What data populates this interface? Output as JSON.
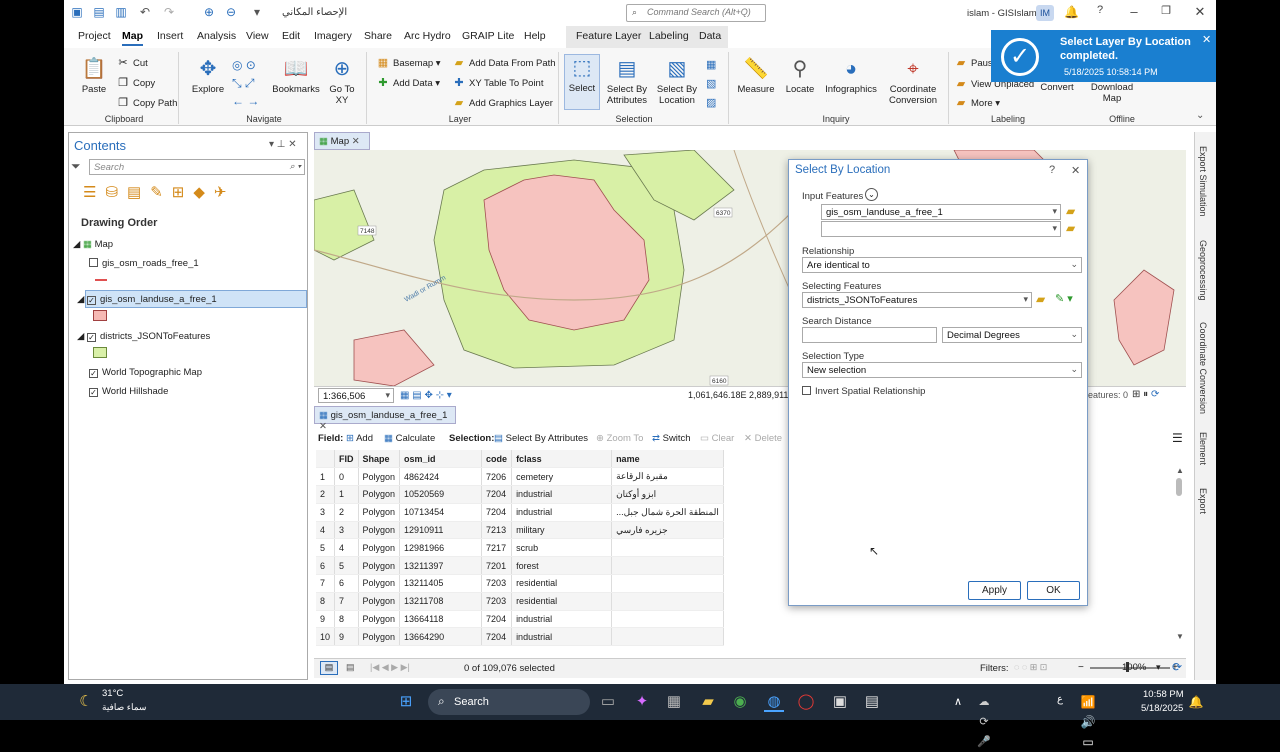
{
  "titlebar": {
    "project": "الإحصاء المكاني",
    "search_placeholder": "Command Search (Alt+Q)",
    "app_title": "islam - GISIslam",
    "avatar": "IM",
    "help": "?"
  },
  "menu": {
    "items": [
      "Project",
      "Map",
      "Insert",
      "Analysis",
      "View",
      "Edit",
      "Imagery",
      "Share",
      "Arc Hydro",
      "GRAIP Lite",
      "Help"
    ],
    "ctx": [
      "Feature Layer",
      "Labeling",
      "Data"
    ]
  },
  "ribbon": {
    "paste": "Paste",
    "cut": "Cut",
    "copy": "Copy",
    "copy_path": "Copy Path",
    "clipboard": "Clipboard",
    "explore": "Explore",
    "bookmarks": "Bookmarks",
    "goto": "Go To XY",
    "navigate": "Navigate",
    "basemap": "Basemap",
    "add_data": "Add Data",
    "add_from_path": "Add Data From Path",
    "xy_table": "XY Table To Point",
    "add_graphics": "Add Graphics Layer",
    "layer": "Layer",
    "select": "Select",
    "sel_attr": "Select By Attributes",
    "sel_loc": "Select By Location",
    "selection": "Selection",
    "measure": "Measure",
    "locate": "Locate",
    "infographics": "Infographics",
    "coord_conv": "Coordinate Conversion",
    "inquiry": "Inquiry",
    "pause": "Pause",
    "view_unplaced": "View Unplaced",
    "more": "More",
    "labeling": "Labeling",
    "convert": "Convert",
    "download_map": "Download Map",
    "offline": "Offline"
  },
  "toast": {
    "title": "Select Layer By Location completed.",
    "time": "5/18/2025 10:58:14 PM"
  },
  "contents": {
    "title": "Contents",
    "search_placeholder": "Search",
    "drawing_order": "Drawing Order",
    "map": "Map",
    "layers": [
      "gis_osm_roads_free_1",
      "gis_osm_landuse_a_free_1",
      "districts_JSONToFeatures",
      "World Topographic Map",
      "World Hillshade"
    ],
    "colors": {
      "roads": "#e05050",
      "landuse": "#f6b9b4",
      "districts": "#d9f0a8"
    }
  },
  "map": {
    "tab": "Map",
    "scale": "1:366,506",
    "coords": "1,061,646.18E 2,889,911.8",
    "features": "eatures: 0",
    "labels": {
      "road1": "6370",
      "road2": "7148",
      "road3": "6160",
      "wadi": "Wadi or Rumm"
    },
    "colors": {
      "landuse": "#f6c3bf",
      "districts": "#d8f0a6",
      "base": "#eef0e6"
    }
  },
  "table": {
    "tab": "gis_osm_landuse_a_free_1",
    "field": "Field:",
    "add": "Add",
    "calculate": "Calculate",
    "selection": "Selection:",
    "sel_attr": "Select By Attributes",
    "zoom": "Zoom To",
    "switch": "Switch",
    "clear": "Clear",
    "delete": "Delete",
    "headers": [
      "FID",
      "Shape",
      "osm_id",
      "code",
      "fclass",
      "name"
    ],
    "rows": [
      [
        "1",
        "0",
        "Polygon",
        "4862424",
        "7206",
        "cemetery",
        "مقبرة الرقاعة"
      ],
      [
        "2",
        "1",
        "Polygon",
        "10520569",
        "7204",
        "industrial",
        "ابزو أوكتان"
      ],
      [
        "3",
        "2",
        "Polygon",
        "10713454",
        "7204",
        "industrial",
        "المنطقة الحرة شمال جبل..."
      ],
      [
        "4",
        "3",
        "Polygon",
        "12910911",
        "7213",
        "military",
        "جزيره فارسي"
      ],
      [
        "5",
        "4",
        "Polygon",
        "12981966",
        "7217",
        "scrub",
        ""
      ],
      [
        "6",
        "5",
        "Polygon",
        "13211397",
        "7201",
        "forest",
        ""
      ],
      [
        "7",
        "6",
        "Polygon",
        "13211405",
        "7203",
        "residential",
        ""
      ],
      [
        "8",
        "7",
        "Polygon",
        "13211708",
        "7203",
        "residential",
        ""
      ],
      [
        "9",
        "8",
        "Polygon",
        "13664118",
        "7204",
        "industrial",
        ""
      ],
      [
        "10",
        "9",
        "Polygon",
        "13664290",
        "7204",
        "industrial",
        ""
      ]
    ],
    "selected": "0 of 109,076 selected"
  },
  "status": {
    "filters": "Filters:",
    "zoom": "100%"
  },
  "dialog": {
    "title": "Select By Location",
    "help": "?",
    "input_features": "Input Features",
    "input1": "gis_osm_landuse_a_free_1",
    "input2": "",
    "relationship": "Relationship",
    "relationship_val": "Are identical to",
    "selecting": "Selecting Features",
    "selecting_val": "districts_JSONToFeatures",
    "distance": "Search Distance",
    "distance_val": "",
    "unit": "Decimal Degrees",
    "sel_type": "Selection Type",
    "sel_type_val": "New selection",
    "invert": "Invert Spatial Relationship",
    "apply": "Apply",
    "ok": "OK"
  },
  "rpanel": [
    "Export Simulation",
    "Geoprocessing",
    "Coordinate Conversion",
    "Element",
    "Export"
  ],
  "taskbar": {
    "temp": "31°C",
    "weather": "سماء صافية",
    "search": "Search",
    "time": "10:58 PM",
    "date": "5/18/2025",
    "lang": "ع"
  }
}
